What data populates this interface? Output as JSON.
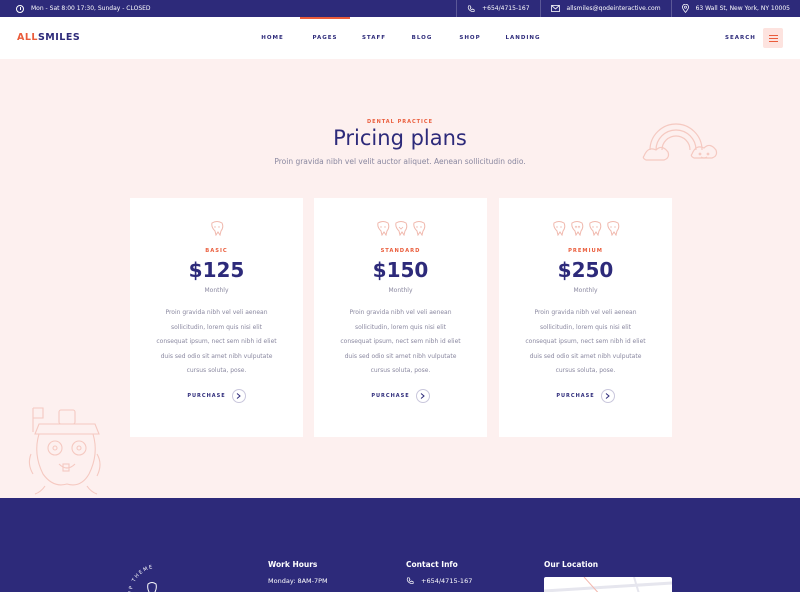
{
  "topbar": {
    "hours": "Mon - Sat 8:00 17:30, Sunday - CLOSED",
    "phone": "+654/4715-167",
    "email": "allsmiles@qodeinteractive.com",
    "address": "63 Wall St, New York, NY 10005"
  },
  "header": {
    "logo_part1": "ALL",
    "logo_part2": "SMILES",
    "nav": [
      {
        "label": "HOME",
        "active": false
      },
      {
        "label": "PAGES",
        "active": true
      },
      {
        "label": "STAFF",
        "active": false
      },
      {
        "label": "BLOG",
        "active": false
      },
      {
        "label": "SHOP",
        "active": false
      },
      {
        "label": "LANDING",
        "active": false
      }
    ],
    "search_label": "SEARCH"
  },
  "pricing": {
    "kicker": "DENTAL PRACTICE",
    "title": "Pricing plans",
    "subtitle": "Proin gravida nibh vel velit auctor aliquet. Aenean sollicitudin odio.",
    "plans": [
      {
        "name": "BASIC",
        "price": "$125",
        "period": "Monthly",
        "description": "Proin gravida nibh vel veli aenean sollicitudin, lorem quis nisi elit consequat ipsum, nect sem nibh id eliet duis sed odio sit amet nibh vulputate cursus soluta, pose.",
        "purchase_label": "PURCHASE"
      },
      {
        "name": "STANDARD",
        "price": "$150",
        "period": "Monthly",
        "description": "Proin gravida nibh vel veli aenean sollicitudin, lorem quis nisi elit consequat ipsum, nect sem nibh id eliet duis sed odio sit amet nibh vulputate cursus soluta, pose.",
        "purchase_label": "PURCHASE"
      },
      {
        "name": "PREMIUM",
        "price": "$250",
        "period": "Monthly",
        "description": "Proin gravida nibh vel veli aenean sollicitudin, lorem quis nisi elit consequat ipsum, nect sem nibh id eliet duis sed odio sit amet nibh vulputate cursus soluta, pose.",
        "purchase_label": "PURCHASE"
      }
    ]
  },
  "footer": {
    "badge_text": "WP THEME",
    "work_hours_title": "Work Hours",
    "work_hours_line": "Monday: 8AM-7PM",
    "contact_title": "Contact Info",
    "contact_phone": "+654/4715-167",
    "location_title": "Our Location"
  },
  "colors": {
    "brand_navy": "#2d2a7a",
    "accent_orange": "#ea5c3b",
    "page_pink": "#fdf0ef"
  }
}
